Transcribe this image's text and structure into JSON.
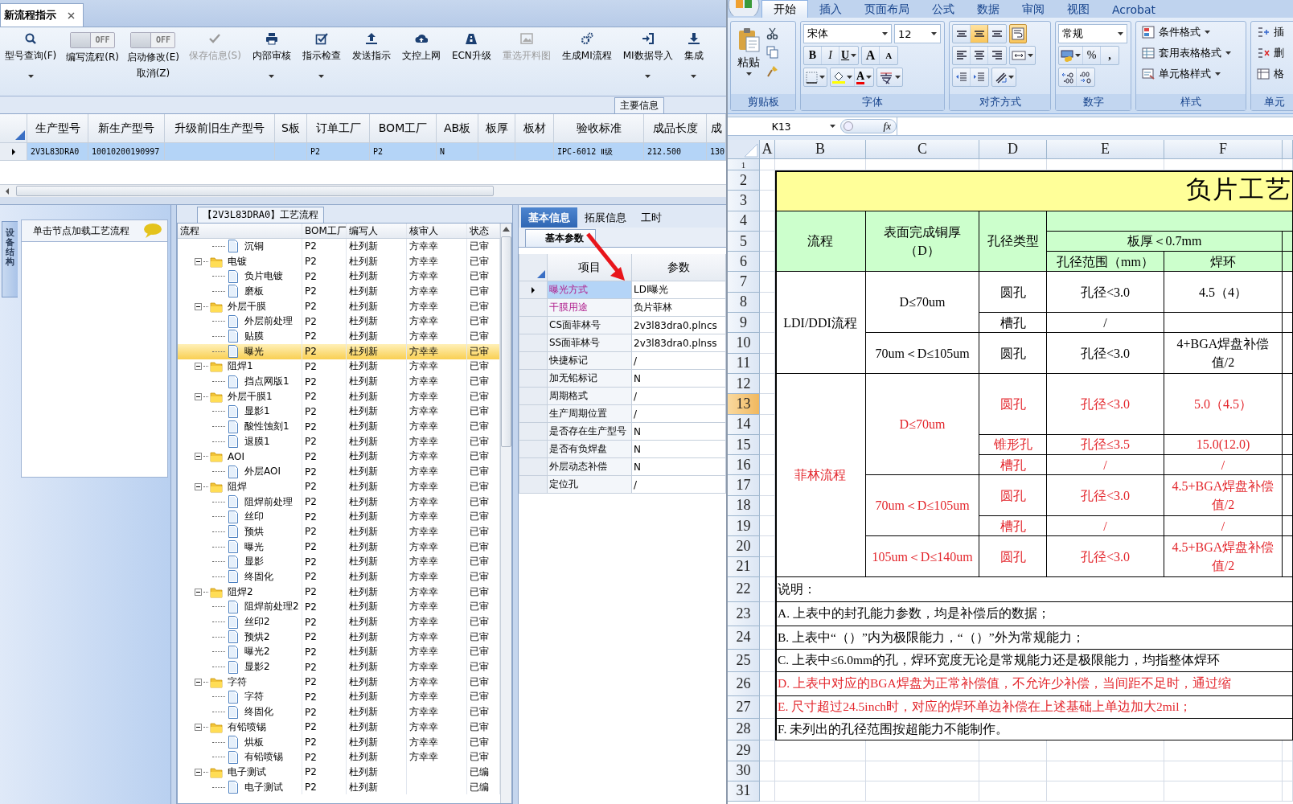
{
  "app": {
    "doc_tabs": [
      {
        "label": "新流程指示",
        "selected": true
      }
    ],
    "toolbar": [
      {
        "kind": "button",
        "label": "型号查询(F)",
        "dropdown": true,
        "disabled": false
      },
      {
        "kind": "toggle",
        "switch_text": "OFF",
        "on": false,
        "label": "编写流程(R)"
      },
      {
        "kind": "toggle",
        "switch_text": "OFF",
        "on": false,
        "label": "启动修改(E)",
        "sublabel": "取消(Z)"
      },
      {
        "kind": "button",
        "label": "保存信息(S)",
        "dropdown": false,
        "disabled": true
      },
      {
        "kind": "button",
        "label": "内部审核",
        "dropdown": true,
        "disabled": false
      },
      {
        "kind": "button",
        "label": "指示检查",
        "dropdown": true,
        "disabled": false
      },
      {
        "kind": "button",
        "label": "发送指示",
        "dropdown": false,
        "disabled": false
      },
      {
        "kind": "button",
        "label": "文控上网",
        "dropdown": false,
        "disabled": false
      },
      {
        "kind": "button",
        "label": "ECN升级",
        "dropdown": false,
        "disabled": false
      },
      {
        "kind": "button",
        "label": "重选开料图",
        "dropdown": false,
        "disabled": true
      },
      {
        "kind": "button",
        "label": "生成MI流程",
        "dropdown": false,
        "disabled": false
      },
      {
        "kind": "button",
        "label": "MI数据导入",
        "dropdown": true,
        "disabled": false
      },
      {
        "kind": "button",
        "label": "集成",
        "dropdown": true,
        "disabled": false
      }
    ],
    "section_label": "主要信息",
    "main_table": {
      "columns": [
        "生产型号",
        "新生产型号",
        "升级前旧生产型号",
        "S板",
        "订单工厂",
        "BOM工厂",
        "AB板",
        "板厚",
        "板材",
        "验收标准",
        "成品长度",
        "成"
      ],
      "rows": [
        {
          "selected": true,
          "cells": [
            "2V3L83DRA0",
            "10010200190997",
            null,
            null,
            "P2",
            "P2",
            "N",
            null,
            null,
            "IPC-6012 Ⅱ级",
            "212.500",
            "130"
          ]
        }
      ]
    },
    "side_tab": "设备结构",
    "hint": "单击节点加载工艺流程",
    "tree": {
      "title": "【2V3L83DRA0】工艺流程",
      "columns": [
        "流程",
        "BOM工厂",
        "编写人",
        "核审人",
        "状态"
      ],
      "nodes": [
        {
          "children": [
            {
              "name": "沉铜",
              "bom": "P2",
              "writer": "杜列新",
              "reviewer": "方幸幸",
              "status": "已审",
              "selected": false
            }
          ]
        },
        {
          "name": "电镀",
          "bom": "P2",
          "writer": "杜列新",
          "reviewer": "方幸幸",
          "status": "已审",
          "selected": false,
          "expanded": true,
          "children": [
            {
              "name": "负片电镀",
              "bom": "P2",
              "writer": "杜列新",
              "reviewer": "方幸幸",
              "status": "已审",
              "selected": false
            },
            {
              "name": "磨板",
              "bom": "P2",
              "writer": "杜列新",
              "reviewer": "方幸幸",
              "status": "已审",
              "selected": false
            }
          ]
        },
        {
          "name": "外层干膜",
          "bom": "P2",
          "writer": "杜列新",
          "reviewer": "方幸幸",
          "status": "已审",
          "selected": false,
          "expanded": true,
          "children": [
            {
              "name": "外层前处理",
              "bom": "P2",
              "writer": "杜列新",
              "reviewer": "方幸幸",
              "status": "已审",
              "selected": false
            },
            {
              "name": "贴膜",
              "bom": "P2",
              "writer": "杜列新",
              "reviewer": "方幸幸",
              "status": "已审",
              "selected": false
            },
            {
              "name": "曝光",
              "bom": "P2",
              "writer": "杜列新",
              "reviewer": "方幸幸",
              "status": "已审",
              "selected": true
            }
          ]
        },
        {
          "name": "阻焊1",
          "bom": "P2",
          "writer": "杜列新",
          "reviewer": "方幸幸",
          "status": "已审",
          "selected": false,
          "expanded": true,
          "children": [
            {
              "name": "挡点网版1",
              "bom": "P2",
              "writer": "杜列新",
              "reviewer": "方幸幸",
              "status": "已审",
              "selected": false
            }
          ]
        },
        {
          "name": "外层干膜1",
          "bom": "P2",
          "writer": "杜列新",
          "reviewer": "方幸幸",
          "status": "已审",
          "selected": false,
          "expanded": true,
          "children": [
            {
              "name": "显影1",
              "bom": "P2",
              "writer": "杜列新",
              "reviewer": "方幸幸",
              "status": "已审",
              "selected": false
            },
            {
              "name": "酸性蚀刻1",
              "bom": "P2",
              "writer": "杜列新",
              "reviewer": "方幸幸",
              "status": "已审",
              "selected": false
            },
            {
              "name": "退膜1",
              "bom": "P2",
              "writer": "杜列新",
              "reviewer": "方幸幸",
              "status": "已审",
              "selected": false
            }
          ]
        },
        {
          "name": "AOI",
          "bom": "P2",
          "writer": "杜列新",
          "reviewer": "方幸幸",
          "status": "已审",
          "selected": false,
          "expanded": true,
          "children": [
            {
              "name": "外层AOI",
              "bom": "P2",
              "writer": "杜列新",
              "reviewer": "方幸幸",
              "status": "已审",
              "selected": false
            }
          ]
        },
        {
          "name": "阻焊",
          "bom": "P2",
          "writer": "杜列新",
          "reviewer": "方幸幸",
          "status": "已审",
          "selected": false,
          "expanded": true,
          "children": [
            {
              "name": "阻焊前处理",
              "bom": "P2",
              "writer": "杜列新",
              "reviewer": "方幸幸",
              "status": "已审",
              "selected": false
            },
            {
              "name": "丝印",
              "bom": "P2",
              "writer": "杜列新",
              "reviewer": "方幸幸",
              "status": "已审",
              "selected": false
            },
            {
              "name": "预烘",
              "bom": "P2",
              "writer": "杜列新",
              "reviewer": "方幸幸",
              "status": "已审",
              "selected": false
            },
            {
              "name": "曝光",
              "bom": "P2",
              "writer": "杜列新",
              "reviewer": "方幸幸",
              "status": "已审",
              "selected": false
            },
            {
              "name": "显影",
              "bom": "P2",
              "writer": "杜列新",
              "reviewer": "方幸幸",
              "status": "已审",
              "selected": false
            },
            {
              "name": "终固化",
              "bom": "P2",
              "writer": "杜列新",
              "reviewer": "方幸幸",
              "status": "已审",
              "selected": false
            }
          ]
        },
        {
          "name": "阻焊2",
          "bom": "P2",
          "writer": "杜列新",
          "reviewer": "方幸幸",
          "status": "已审",
          "selected": false,
          "expanded": true,
          "children": [
            {
              "name": "阻焊前处理2",
              "bom": "P2",
              "writer": "杜列新",
              "reviewer": "方幸幸",
              "status": "已审",
              "selected": false
            },
            {
              "name": "丝印2",
              "bom": "P2",
              "writer": "杜列新",
              "reviewer": "方幸幸",
              "status": "已审",
              "selected": false
            },
            {
              "name": "预烘2",
              "bom": "P2",
              "writer": "杜列新",
              "reviewer": "方幸幸",
              "status": "已审",
              "selected": false
            },
            {
              "name": "曝光2",
              "bom": "P2",
              "writer": "杜列新",
              "reviewer": "方幸幸",
              "status": "已审",
              "selected": false
            },
            {
              "name": "显影2",
              "bom": "P2",
              "writer": "杜列新",
              "reviewer": "方幸幸",
              "status": "已审",
              "selected": false
            }
          ]
        },
        {
          "name": "字符",
          "bom": "P2",
          "writer": "杜列新",
          "reviewer": "方幸幸",
          "status": "已审",
          "selected": false,
          "expanded": true,
          "children": [
            {
              "name": "字符",
              "bom": "P2",
              "writer": "杜列新",
              "reviewer": "方幸幸",
              "status": "已审",
              "selected": false
            },
            {
              "name": "终固化",
              "bom": "P2",
              "writer": "杜列新",
              "reviewer": "方幸幸",
              "status": "已审",
              "selected": false
            }
          ]
        },
        {
          "name": "有铅喷锡",
          "bom": "P2",
          "writer": "杜列新",
          "reviewer": "方幸幸",
          "status": "已审",
          "selected": false,
          "expanded": true,
          "children": [
            {
              "name": "烘板",
              "bom": "P2",
              "writer": "杜列新",
              "reviewer": "方幸幸",
              "status": "已审",
              "selected": false
            },
            {
              "name": "有铅喷锡",
              "bom": "P2",
              "writer": "杜列新",
              "reviewer": "方幸幸",
              "status": "已审",
              "selected": false
            }
          ]
        },
        {
          "name": "电子测试",
          "bom": "P2",
          "writer": "杜列新",
          "status": "已编",
          "selected": false,
          "expanded": true,
          "children": [
            {
              "name": "电子测试",
              "bom": "P2",
              "writer": "杜列新",
              "status": "已编",
              "selected": false
            }
          ]
        }
      ]
    },
    "detail": {
      "tabs": [
        {
          "label": "基本信息",
          "selected": true
        },
        {
          "label": "拓展信息",
          "selected": false
        },
        {
          "label": "工时",
          "selected": false
        }
      ],
      "subtab": {
        "label": "基本参数",
        "selected": true
      },
      "columns": [
        "项目",
        "参数"
      ],
      "rows": [
        {
          "item": "曝光方式",
          "value": "LDI曝光",
          "selected": true,
          "highlighted": true
        },
        {
          "item": "干膜用途",
          "value": "负片菲林",
          "selected": false,
          "highlighted": true
        },
        {
          "item": "CS面菲林号",
          "value": "2v3l83dra0.plncs",
          "selected": false,
          "highlighted": false
        },
        {
          "item": "SS面菲林号",
          "value": "2v3l83dra0.plnss",
          "selected": false,
          "highlighted": false
        },
        {
          "item": "快捷标记",
          "value": "/",
          "selected": false,
          "highlighted": false
        },
        {
          "item": "加无铅标记",
          "value": "N",
          "selected": false,
          "highlighted": false
        },
        {
          "item": "周期格式",
          "value": "/",
          "selected": false,
          "highlighted": false
        },
        {
          "item": "生产周期位置",
          "value": "/",
          "selected": false,
          "highlighted": false
        },
        {
          "item": "是否存在生产型号",
          "value": "N",
          "selected": false,
          "highlighted": false
        },
        {
          "item": "是否有负焊盘",
          "value": "N",
          "selected": false,
          "highlighted": false
        },
        {
          "item": "外层动态补偿",
          "value": "N",
          "selected": false,
          "highlighted": false
        },
        {
          "item": "定位孔",
          "value": "/",
          "selected": false,
          "highlighted": false
        }
      ],
      "annotations": [
        {
          "kind": "arrow"
        }
      ]
    }
  },
  "excel": {
    "tabs": [
      {
        "label": "开始",
        "selected": true
      },
      {
        "label": "插入",
        "selected": false
      },
      {
        "label": "页面布局",
        "selected": false
      },
      {
        "label": "公式",
        "selected": false
      },
      {
        "label": "数据",
        "selected": false
      },
      {
        "label": "审阅",
        "selected": false
      },
      {
        "label": "视图",
        "selected": false
      },
      {
        "label": "Acrobat",
        "selected": false
      }
    ],
    "ribbon": {
      "clipboard": {
        "title": "剪贴板",
        "paste": "粘贴"
      },
      "font": {
        "title": "字体",
        "face": "宋体",
        "size": "12",
        "bold": "B",
        "italic": "I",
        "underline": "U",
        "grow": "A",
        "shrink": "A",
        "font_color": "A"
      },
      "alignment": {
        "title": "对齐方式",
        "vertical": [
          {
            "selected": false
          },
          {
            "selected": true
          },
          {
            "selected": false
          }
        ],
        "wrap_text": {
          "selected": true
        }
      },
      "number": {
        "title": "数字",
        "format": "常规",
        "percent": "%",
        "comma": ","
      },
      "styles": {
        "title": "样式",
        "items": [
          "条件格式",
          "套用表格格式",
          "单元格样式"
        ]
      },
      "cells": {
        "title": "单元",
        "items": [
          "插",
          "删",
          "格"
        ]
      }
    },
    "name_box": "K13",
    "fx": "fx",
    "columns": [
      "A",
      "B",
      "C",
      "D",
      "E",
      "F"
    ],
    "rows": [
      {
        "label": "1",
        "selected": false
      },
      {
        "label": "2",
        "selected": false
      },
      {
        "label": "3",
        "selected": false
      },
      {
        "label": "4",
        "selected": false
      },
      {
        "label": "5",
        "selected": false
      },
      {
        "label": "6",
        "selected": false
      },
      {
        "label": "7",
        "selected": false
      },
      {
        "label": "8",
        "selected": false
      },
      {
        "label": "9",
        "selected": false
      },
      {
        "label": "10",
        "selected": false
      },
      {
        "label": "11",
        "selected": false
      },
      {
        "label": "12",
        "selected": false
      },
      {
        "label": "13",
        "selected": true
      },
      {
        "label": "14",
        "selected": false
      },
      {
        "label": "15",
        "selected": false
      },
      {
        "label": "16",
        "selected": false
      },
      {
        "label": "17",
        "selected": false
      },
      {
        "label": "18",
        "selected": false
      },
      {
        "label": "19",
        "selected": false
      },
      {
        "label": "20",
        "selected": false
      },
      {
        "label": "21",
        "selected": false
      },
      {
        "label": "22",
        "selected": false
      },
      {
        "label": "23",
        "selected": false
      },
      {
        "label": "24",
        "selected": false
      },
      {
        "label": "25",
        "selected": false
      },
      {
        "label": "26",
        "selected": false
      },
      {
        "label": "27",
        "selected": false
      },
      {
        "label": "28",
        "selected": false
      },
      {
        "label": "29",
        "selected": false
      },
      {
        "label": "30",
        "selected": false
      },
      {
        "label": "31",
        "selected": false
      }
    ],
    "sheet": {
      "title": "负片工艺",
      "header": {
        "flow": "流程",
        "copper": "表面完成铜厚（D）",
        "hole_type": "孔径类型",
        "thickness": "板厚＜0.7mm",
        "range": "孔径范围（mm）",
        "ring": "焊环"
      },
      "groups": [
        {
          "flow": "LDI/DDI流程",
          "highlighted": false,
          "coppers": [
            {
              "copper": "D≤70um",
              "holes": [
                {
                  "type": "圆孔",
                  "range": "孔径<3.0",
                  "ring": "4.5（4）"
                },
                {
                  "type": "槽孔",
                  "range": "/"
                }
              ]
            },
            {
              "copper": "70um＜D≤105um",
              "holes": [
                {
                  "type": "圆孔",
                  "range": "孔径<3.0",
                  "ring": "4+BGA焊盘补偿值/2"
                }
              ]
            }
          ]
        },
        {
          "flow": "菲林流程",
          "highlighted": true,
          "coppers": [
            {
              "copper": "D≤70um",
              "holes": [
                {
                  "type": "圆孔",
                  "range": "孔径<3.0",
                  "ring": "5.0（4.5）"
                },
                {
                  "type": "锥形孔",
                  "range": "孔径≤3.5",
                  "ring": "15.0(12.0)"
                },
                {
                  "type": "槽孔",
                  "range": "/",
                  "ring": "/"
                }
              ]
            },
            {
              "copper": "70um＜D≤105um",
              "holes": [
                {
                  "type": "圆孔",
                  "range": "孔径<3.0",
                  "ring": "4.5+BGA焊盘补偿值/2"
                },
                {
                  "type": "槽孔",
                  "range": "/",
                  "ring": "/"
                }
              ]
            },
            {
              "copper": "105um＜D≤140um",
              "holes": [
                {
                  "type": "圆孔",
                  "range": "孔径<3.0",
                  "ring": "4.5+BGA焊盘补偿值/2"
                }
              ]
            }
          ]
        }
      ],
      "notes": [
        {
          "text": "说明：",
          "highlighted": false
        },
        {
          "text": "A. 上表中的封孔能力参数，均是补偿后的数据；",
          "highlighted": false
        },
        {
          "text": "B. 上表中“（）”内为极限能力，“（）”外为常规能力；",
          "highlighted": false
        },
        {
          "text": "C. 上表中≤6.0mm的孔，焊环宽度无论是常规能力还是极限能力，均指整体焊环",
          "highlighted": false
        },
        {
          "text": "D. 上表中对应的BGA焊盘为正常补偿值，不允许少补偿，当间距不足时，通过缩",
          "highlighted": true
        },
        {
          "text": "E. 尺寸超过24.5inch时，对应的焊环单边补偿在上述基础上单边加大2mil；",
          "highlighted": true
        },
        {
          "text": "F. 未列出的孔径范围按超能力不能制作。",
          "highlighted": false
        }
      ]
    }
  }
}
